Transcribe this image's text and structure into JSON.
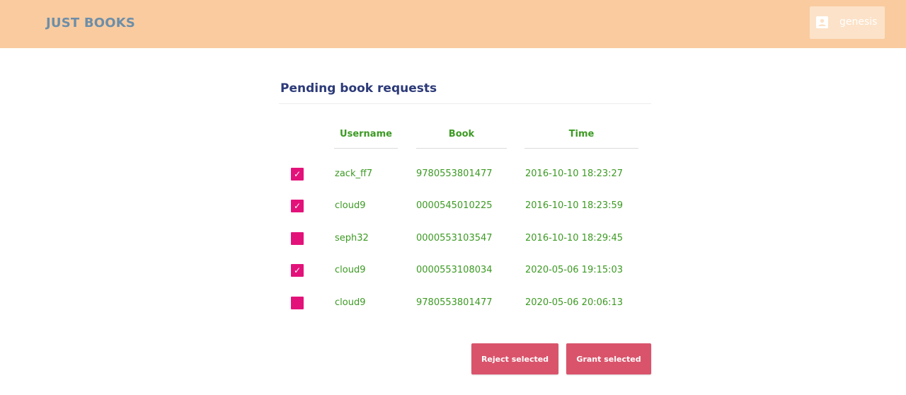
{
  "app": {
    "brand": "JUST BOOKS"
  },
  "user": {
    "name": "genesis",
    "icon": "account-box-icon"
  },
  "page": {
    "heading": "Pending book requests"
  },
  "table": {
    "headers": {
      "username": "Username",
      "book": "Book",
      "time": "Time"
    },
    "rows": [
      {
        "checked": true,
        "username": "zack_ff7",
        "book": "9780553801477",
        "time": "2016-10-10 18:23:27"
      },
      {
        "checked": true,
        "username": "cloud9",
        "book": "0000545010225",
        "time": "2016-10-10 18:23:59"
      },
      {
        "checked": false,
        "username": "seph32",
        "book": "0000553103547",
        "time": "2016-10-10 18:29:45"
      },
      {
        "checked": true,
        "username": "cloud9",
        "book": "0000553108034",
        "time": "2020-05-06 19:15:03"
      },
      {
        "checked": false,
        "username": "cloud9",
        "book": "9780553801477",
        "time": "2020-05-06 20:06:13"
      }
    ]
  },
  "actions": {
    "reject_label": "Reject selected",
    "grant_label": "Grant selected"
  },
  "colors": {
    "topbar": "#f9cb9f",
    "brand": "#6d8ea8",
    "heading": "#2c3a78",
    "table_text": "#3c9a23",
    "checkbox": "#e3127a",
    "button": "#d9546b"
  }
}
